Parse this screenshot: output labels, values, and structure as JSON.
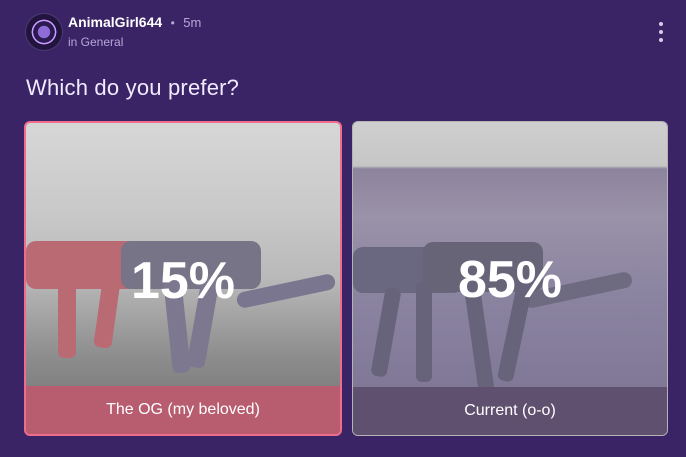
{
  "post": {
    "username": "AnimalGirl644",
    "separator": "•",
    "time": "5m",
    "location": "in General",
    "question": "Which do you prefer?"
  },
  "poll": {
    "options": [
      {
        "label": "The OG (my beloved)",
        "percent": "15%",
        "selected": true
      },
      {
        "label": "Current (o-o)",
        "percent": "85%",
        "selected": false
      }
    ]
  },
  "icons": {
    "avatar": "avatar-icon",
    "menu": "more-vertical-icon"
  },
  "colors": {
    "background": "#3a2466",
    "selected_border": "#f06b8c"
  }
}
